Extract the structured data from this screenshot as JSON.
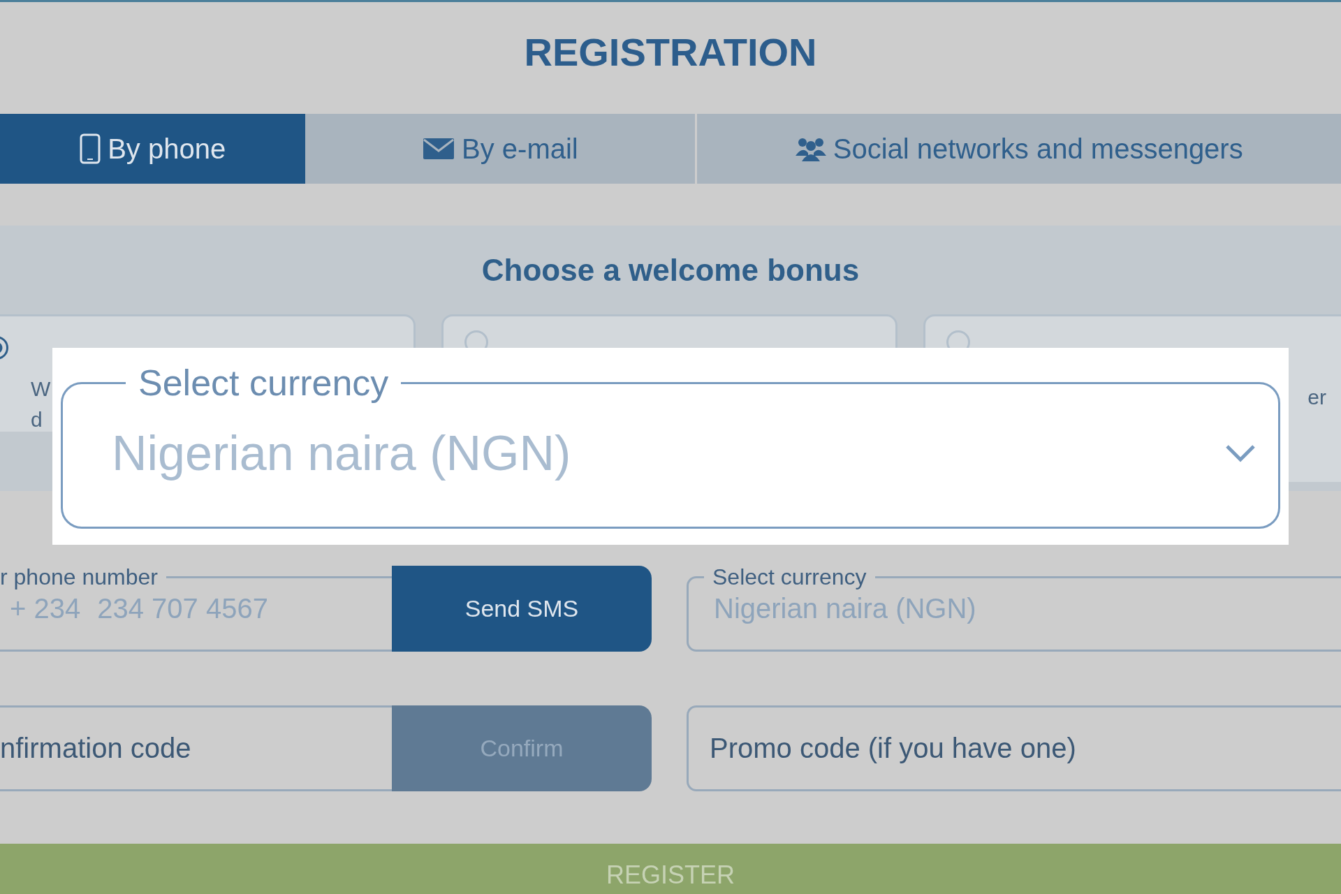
{
  "title": "REGISTRATION",
  "tabs": [
    {
      "label": "By phone",
      "kind": "phone",
      "selected": true
    },
    {
      "label": "By e-mail",
      "kind": "email",
      "selected": false
    },
    {
      "label": "Social networks and messengers",
      "kind": "social",
      "selected": false
    }
  ],
  "bonus": {
    "heading": "Choose a welcome bonus",
    "cards": [
      {
        "selected": true,
        "lines": [
          "W",
          "d"
        ]
      },
      {
        "selected": false
      },
      {
        "selected": false,
        "lines": [
          "er"
        ]
      }
    ]
  },
  "magnifier": {
    "label": "Select currency",
    "value": "Nigerian naira (NGN)"
  },
  "form": {
    "phone": {
      "label": "r phone number",
      "code": "+ 234",
      "value": "234 707 4567"
    },
    "send_button": "Send SMS",
    "currency": {
      "label": "Select currency",
      "value": "Nigerian naira (NGN)"
    },
    "code_field": {
      "placeholder": "nfirmation code"
    },
    "confirm_button": {
      "label": "Confirm",
      "disabled": true
    },
    "promo": {
      "placeholder": "Promo code (if you have one)"
    }
  },
  "register_button": "REGISTER"
}
